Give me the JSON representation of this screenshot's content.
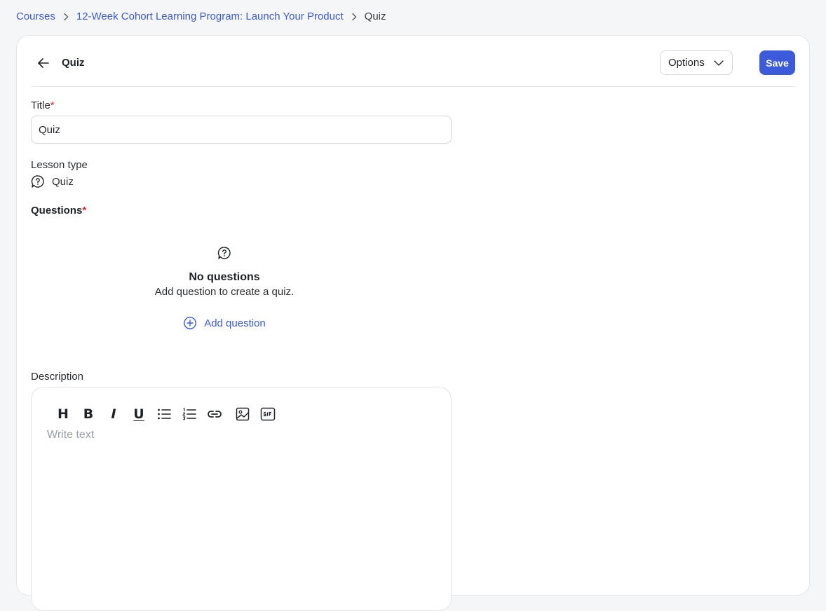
{
  "breadcrumb": {
    "items": [
      "Courses",
      "12-Week Cohort Learning Program: Launch Your Product"
    ],
    "current": "Quiz"
  },
  "header": {
    "title": "Quiz",
    "options_label": "Options",
    "save_label": "Save"
  },
  "form": {
    "title_label": "Title",
    "required_mark": "*",
    "title_value": "Quiz",
    "lesson_type_label": "Lesson type",
    "lesson_type_value": "Quiz",
    "questions_label": "Questions"
  },
  "empty_state": {
    "title": "No questions",
    "subtitle": "Add question to create a quiz.",
    "add_label": "Add question"
  },
  "description": {
    "label": "Description",
    "placeholder": "Write text"
  },
  "toolbar": {
    "heading": "H",
    "bold": "B",
    "italic": "I",
    "underline": "U"
  },
  "colors": {
    "accent": "#3b5bdb",
    "required": "#e03131",
    "background": "#f5f6f8"
  },
  "icons": [
    "chevron-right-icon",
    "arrow-left-icon",
    "chevron-down-icon",
    "quiz-bubble-icon",
    "plus-circle-icon",
    "bullet-list-icon",
    "numbered-list-icon",
    "link-icon",
    "image-icon",
    "gif-icon"
  ]
}
